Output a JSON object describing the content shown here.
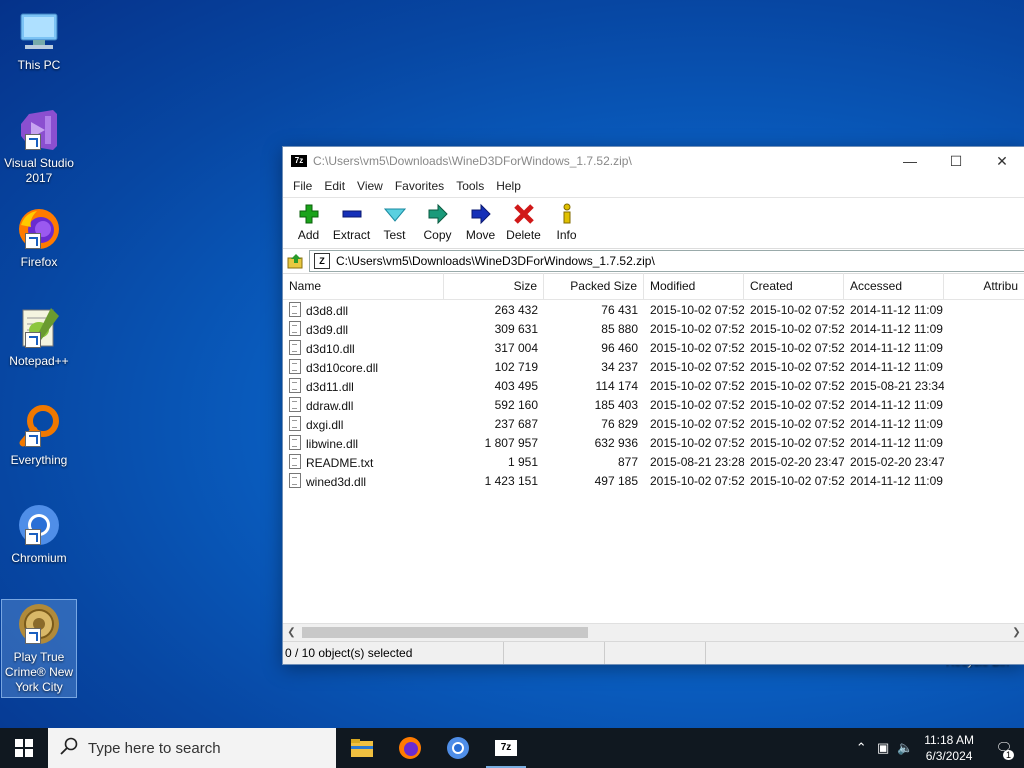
{
  "desktop": {
    "icons": [
      {
        "label": "This PC"
      },
      {
        "label": "Visual Studio 2017"
      },
      {
        "label": "Firefox"
      },
      {
        "label": "Notepad++"
      },
      {
        "label": "Everything"
      },
      {
        "label": "Chromium"
      },
      {
        "label": "Play True Crime® New York City"
      }
    ],
    "recycle_label": "Recycle Bin"
  },
  "window": {
    "title": "C:\\Users\\vm5\\Downloads\\WineD3DForWindows_1.7.52.zip\\",
    "app_icon_text": "7z",
    "menu": [
      "File",
      "Edit",
      "View",
      "Favorites",
      "Tools",
      "Help"
    ],
    "toolbar": [
      {
        "label": "Add",
        "icon": "plus-icon",
        "color": "#1aa31a"
      },
      {
        "label": "Extract",
        "icon": "minus-icon",
        "color": "#1530b8"
      },
      {
        "label": "Test",
        "icon": "check-icon",
        "color": "#2ab0c0"
      },
      {
        "label": "Copy",
        "icon": "copy-arrow-icon",
        "color": "#1a9a7a"
      },
      {
        "label": "Move",
        "icon": "move-arrow-icon",
        "color": "#1530b8"
      },
      {
        "label": "Delete",
        "icon": "delete-x-icon",
        "color": "#d01818"
      },
      {
        "label": "Info",
        "icon": "info-icon",
        "color": "#c8a800"
      }
    ],
    "address": "C:\\Users\\vm5\\Downloads\\WineD3DForWindows_1.7.52.zip\\",
    "columns": [
      "Name",
      "Size",
      "Packed Size",
      "Modified",
      "Created",
      "Accessed",
      "Attribu"
    ],
    "files": [
      {
        "name": "d3d8.dll",
        "size": "263 432",
        "packed": "76 431",
        "modified": "2015-10-02 07:52",
        "created": "2015-10-02 07:52",
        "accessed": "2014-11-12 11:09"
      },
      {
        "name": "d3d9.dll",
        "size": "309 631",
        "packed": "85 880",
        "modified": "2015-10-02 07:52",
        "created": "2015-10-02 07:52",
        "accessed": "2014-11-12 11:09"
      },
      {
        "name": "d3d10.dll",
        "size": "317 004",
        "packed": "96 460",
        "modified": "2015-10-02 07:52",
        "created": "2015-10-02 07:52",
        "accessed": "2014-11-12 11:09"
      },
      {
        "name": "d3d10core.dll",
        "size": "102 719",
        "packed": "34 237",
        "modified": "2015-10-02 07:52",
        "created": "2015-10-02 07:52",
        "accessed": "2014-11-12 11:09"
      },
      {
        "name": "d3d11.dll",
        "size": "403 495",
        "packed": "114 174",
        "modified": "2015-10-02 07:52",
        "created": "2015-10-02 07:52",
        "accessed": "2015-08-21 23:34"
      },
      {
        "name": "ddraw.dll",
        "size": "592 160",
        "packed": "185 403",
        "modified": "2015-10-02 07:52",
        "created": "2015-10-02 07:52",
        "accessed": "2014-11-12 11:09"
      },
      {
        "name": "dxgi.dll",
        "size": "237 687",
        "packed": "76 829",
        "modified": "2015-10-02 07:52",
        "created": "2015-10-02 07:52",
        "accessed": "2014-11-12 11:09"
      },
      {
        "name": "libwine.dll",
        "size": "1 807 957",
        "packed": "632 936",
        "modified": "2015-10-02 07:52",
        "created": "2015-10-02 07:52",
        "accessed": "2014-11-12 11:09"
      },
      {
        "name": "README.txt",
        "size": "1 951",
        "packed": "877",
        "modified": "2015-08-21 23:28",
        "created": "2015-02-20 23:47",
        "accessed": "2015-02-20 23:47"
      },
      {
        "name": "wined3d.dll",
        "size": "1 423 151",
        "packed": "497 185",
        "modified": "2015-10-02 07:52",
        "created": "2015-10-02 07:52",
        "accessed": "2014-11-12 11:09"
      }
    ],
    "status": "0 / 10 object(s) selected"
  },
  "taskbar": {
    "search_placeholder": "Type here to search",
    "time": "11:18 AM",
    "date": "6/3/2024",
    "notification_count": "1"
  }
}
